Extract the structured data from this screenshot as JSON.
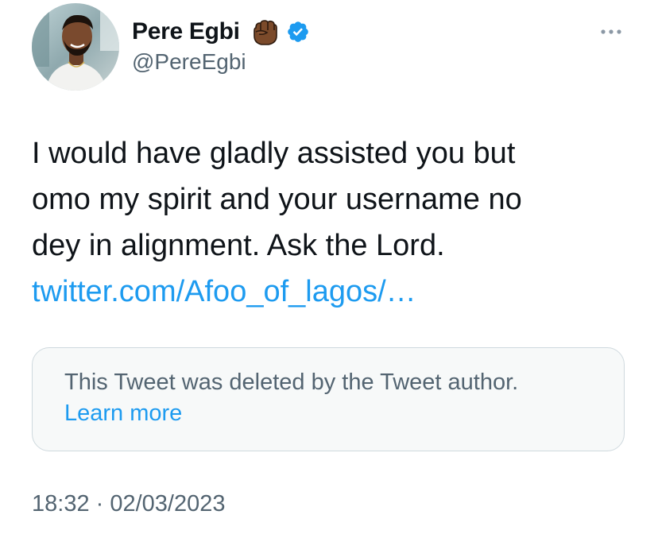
{
  "author": {
    "display_name": "Pere Egbi",
    "handle": "@PereEgbi",
    "emoji": "✊🏾",
    "verified": true
  },
  "tweet": {
    "lines": [
      "I would have gladly assisted you but",
      "omo my spirit and your username no",
      "dey in alignment.  Ask the Lord."
    ],
    "link_text": "twitter.com/Afoo_of_lagos/…"
  },
  "quoted_tweet": {
    "notice": "This Tweet was deleted by the Tweet author.",
    "learn_more": "Learn more"
  },
  "timestamp": "18:32 · 02/03/2023",
  "colors": {
    "accent": "#1d9bf0",
    "secondary_text": "#536471",
    "border": "#cfd9de",
    "card_background": "#f7f9f9"
  },
  "icons": [
    "more-horizontal-icon",
    "verified-badge-icon",
    "raised-fist-icon"
  ]
}
